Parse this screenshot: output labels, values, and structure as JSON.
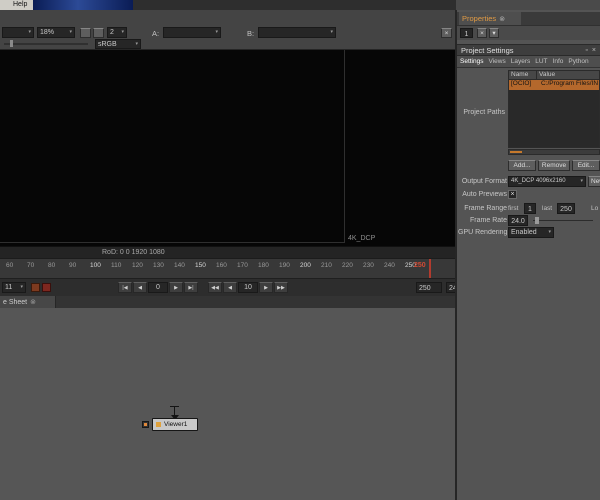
{
  "icons": {
    "dropdown_arrow": "▾",
    "close": "×",
    "tab_close": "⊗",
    "float_panel": "▫",
    "checkbox_check": "×"
  },
  "menubar": {
    "help_label": "Help"
  },
  "viewer_toolbar": {
    "layer_value": "",
    "zoom_value": "18%",
    "gain_value": "2",
    "a_label": "A:",
    "a_value": "",
    "b_label": "B:",
    "b_value": "",
    "colorspace_value": "sRGB"
  },
  "viewer": {
    "format_label": "4K_DCP",
    "rod_text": "RoD: 0 0 1920 1080"
  },
  "timeline": {
    "ticks": [
      "60",
      "70",
      "80",
      "90",
      "100",
      "110",
      "120",
      "130",
      "140",
      "150",
      "160",
      "170",
      "180",
      "190",
      "200",
      "210",
      "220",
      "230",
      "240",
      "250"
    ],
    "playhead_frame": "250",
    "increment_value": "11",
    "current_frame_value": "0",
    "step_value": "10",
    "range_end_value": "250",
    "fps_value": "24",
    "transport": {
      "to_start": "|◀",
      "play_backward": "◀",
      "play_forward": "▶",
      "to_end": "▶|",
      "jump_backward": "◀◀",
      "prev_frame": "◀",
      "next_frame": "▶",
      "jump_forward": "▶▶"
    }
  },
  "dopesheet_tab": {
    "label": "e Sheet"
  },
  "nodegraph": {
    "viewer_node_label": "Viewer1"
  },
  "properties_panel": {
    "tab_label": "Properties",
    "max_panels_value": "1",
    "header_title": "Project Settings",
    "tabs": [
      "Settings",
      "Views",
      "Layers",
      "LUT",
      "Info",
      "Python"
    ],
    "table": {
      "name_header": "Name",
      "value_header": "Value",
      "rows": [
        {
          "name": "[OCIO]",
          "value": "C:/Program Files/IN"
        }
      ]
    },
    "project_paths_label": "Project Paths",
    "buttons": {
      "add": "Add...",
      "remove": "Remove",
      "edit": "Edit..."
    },
    "output_format": {
      "label": "Output Format",
      "value": "4K_DCP 4096x2160",
      "new_button": "New"
    },
    "auto_previews": {
      "label": "Auto Previews"
    },
    "frame_range": {
      "label": "Frame Range",
      "first_label": "first",
      "first_value": "1",
      "last_label": "last",
      "last_value": "250",
      "lock_label": "Lo"
    },
    "frame_rate": {
      "label": "Frame Rate",
      "value": "24.0"
    },
    "gpu_rendering": {
      "label": "GPU Rendering",
      "value": "Enabled"
    }
  }
}
